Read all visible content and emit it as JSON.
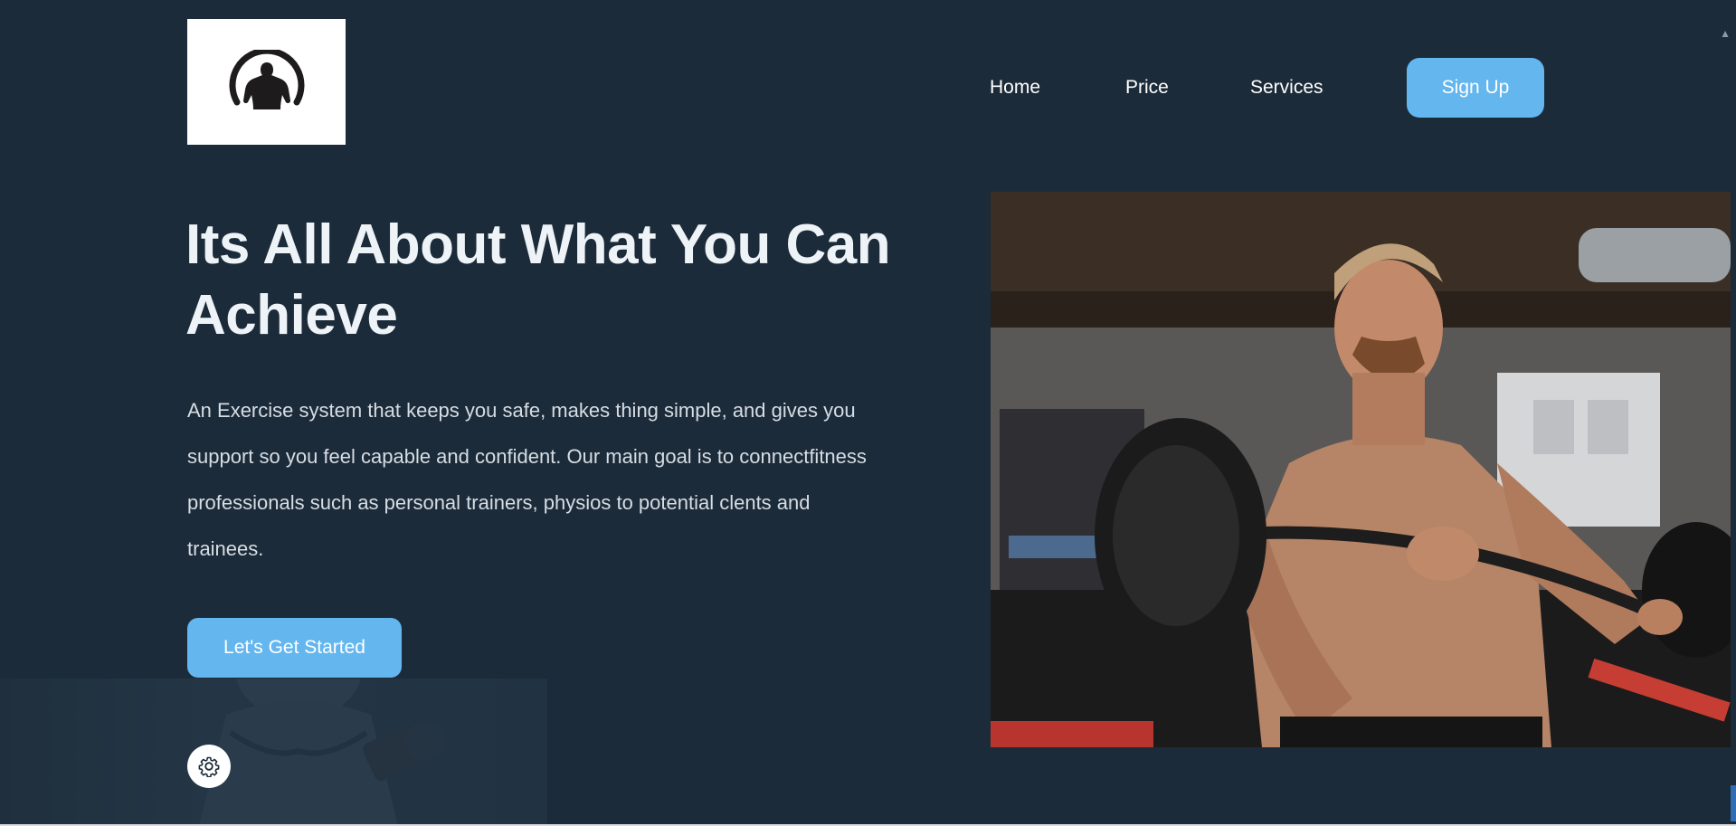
{
  "nav": {
    "home": "Home",
    "price": "Price",
    "services": "Services",
    "signup": "Sign Up"
  },
  "hero": {
    "headline": "Its All About What You Can Achieve",
    "description": "An Exercise system that keeps you safe, makes thing simple, and gives you support so you feel capable and confident. Our main goal is to connectfitness professionals such as personal trainers, physios to potential clents and trainees.",
    "cta_label": "Let's Get Started"
  },
  "icons": {
    "logo": "bodybuilder-logo-icon",
    "settings": "gear-icon"
  },
  "colors": {
    "background": "#1c2b39",
    "accent": "#64b6ef",
    "text": "#ffffff"
  }
}
